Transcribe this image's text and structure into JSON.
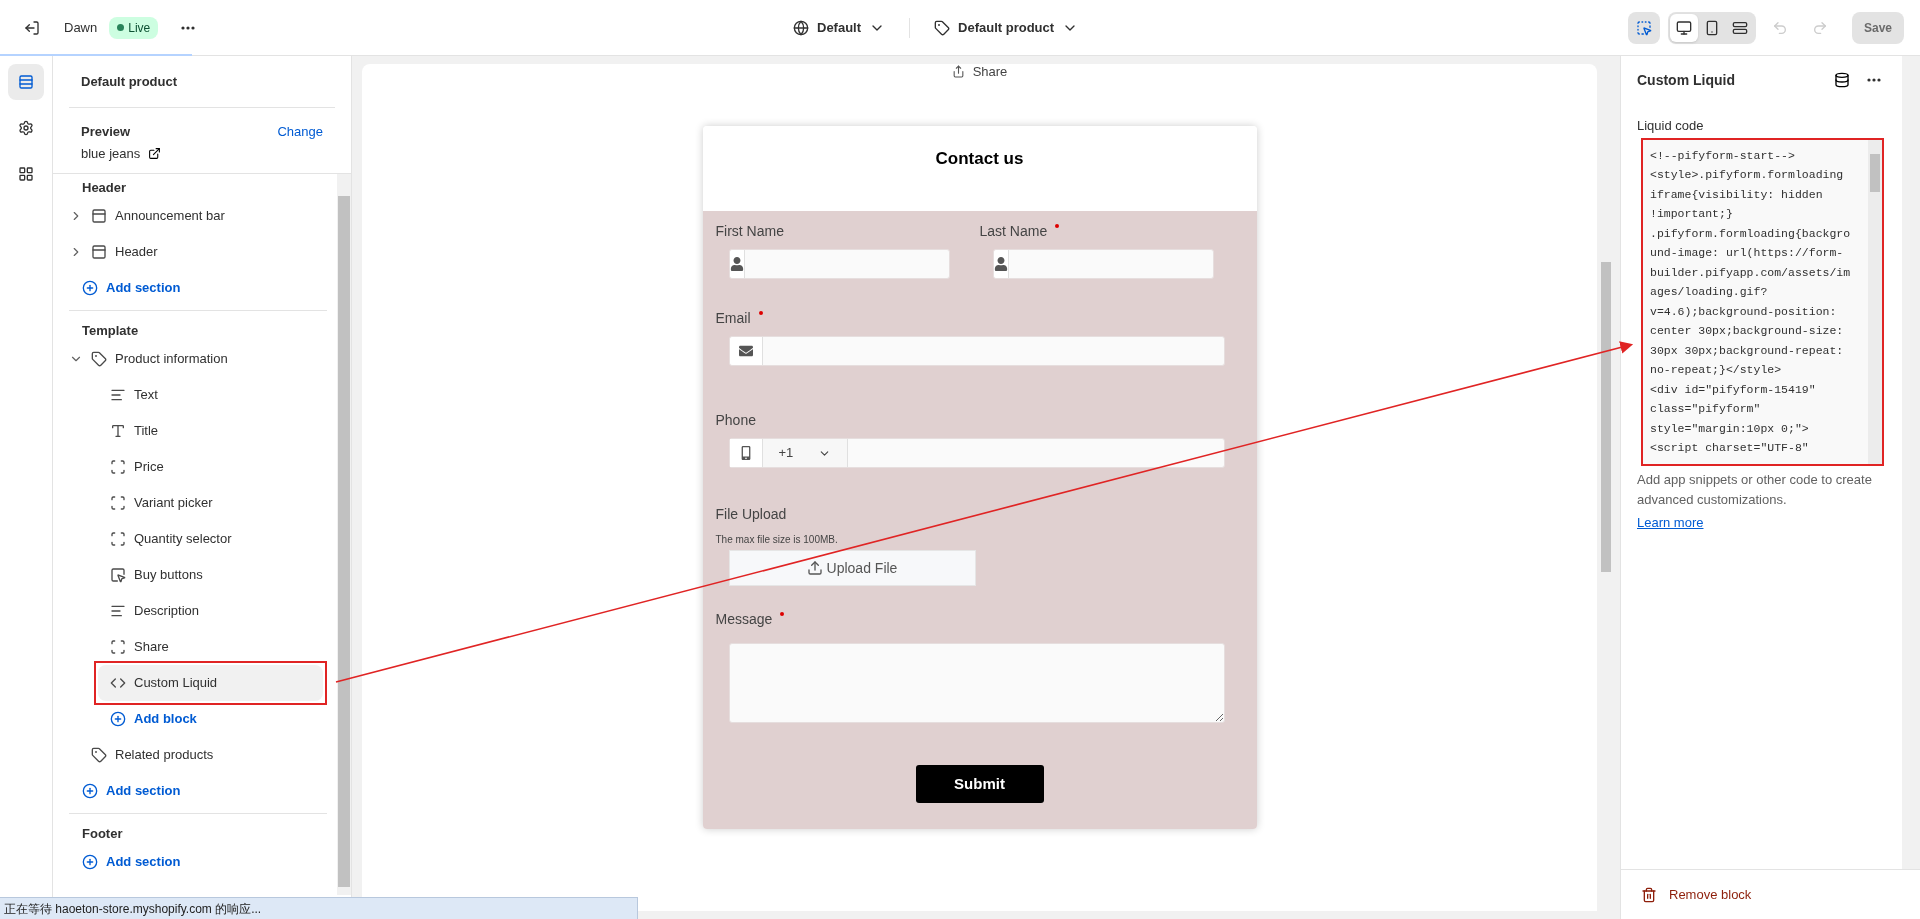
{
  "topbar": {
    "theme": "Dawn",
    "status": "Live",
    "locale": "Default",
    "template": "Default product",
    "tools": [
      {
        "kind": "inspector",
        "selected": true
      }
    ],
    "viewports": [
      {
        "kind": "desktop",
        "selected": true
      },
      {
        "kind": "mobile",
        "selected": false
      },
      {
        "kind": "fullwidth",
        "selected": false
      }
    ],
    "history": [
      {
        "kind": "undo",
        "disabled": true
      },
      {
        "kind": "redo",
        "disabled": true
      }
    ],
    "save": {
      "label": "Save",
      "disabled": true
    }
  },
  "rail": [
    {
      "kind": "sections",
      "selected": true
    },
    {
      "kind": "settings",
      "selected": false
    },
    {
      "kind": "apps",
      "selected": false
    }
  ],
  "sidebar": {
    "title": "Default product",
    "preview": {
      "label": "Preview",
      "action": "Change",
      "value": "blue jeans"
    },
    "groups": [
      {
        "title": "Header",
        "items": [
          {
            "label": "Announcement bar",
            "kind": "section",
            "expanded": false
          },
          {
            "label": "Header",
            "kind": "section",
            "expanded": false
          }
        ],
        "add": "Add section"
      },
      {
        "title": "Template",
        "items": [
          {
            "label": "Product information",
            "kind": "tag",
            "expanded": true,
            "add_block": "Add block",
            "children": [
              {
                "label": "Text",
                "kind": "text",
                "selected": false,
                "annotated": false
              },
              {
                "label": "Title",
                "kind": "title",
                "selected": false,
                "annotated": false
              },
              {
                "label": "Price",
                "kind": "frame",
                "selected": false,
                "annotated": false
              },
              {
                "label": "Variant picker",
                "kind": "frame",
                "selected": false,
                "annotated": false
              },
              {
                "label": "Quantity selector",
                "kind": "frame",
                "selected": false,
                "annotated": false
              },
              {
                "label": "Buy buttons",
                "kind": "buy",
                "selected": false,
                "annotated": false
              },
              {
                "label": "Description",
                "kind": "text",
                "selected": false,
                "annotated": false
              },
              {
                "label": "Share",
                "kind": "frame",
                "selected": false,
                "annotated": false
              },
              {
                "label": "Custom Liquid",
                "kind": "code",
                "selected": true,
                "annotated": true
              }
            ]
          },
          {
            "label": "Related products",
            "kind": "tag"
          }
        ],
        "add": "Add section"
      },
      {
        "title": "Footer",
        "add": "Add section"
      }
    ]
  },
  "preview": {
    "share": "Share",
    "form": {
      "title": "Contact us",
      "fields": [
        {
          "kind": "name",
          "label": "First Name",
          "required": false
        },
        {
          "kind": "name",
          "label": "Last Name",
          "required": true
        },
        {
          "kind": "email",
          "label": "Email",
          "required": true
        },
        {
          "kind": "phone",
          "label": "Phone",
          "required": false,
          "country": "+1"
        },
        {
          "kind": "file",
          "label": "File Upload",
          "required": false,
          "hint": "The max file size is 100MB.",
          "button": "Upload File"
        },
        {
          "kind": "textarea",
          "label": "Message",
          "required": true
        }
      ],
      "submit": "Submit"
    }
  },
  "inspector": {
    "title": "Custom Liquid",
    "field_label": "Liquid code",
    "annotated": true,
    "code": [
      "<!--pifyform-start-->",
      "<style>.pifyform.formloading",
      "iframe{visibility: hidden",
      "!important;}",
      ".pifyform.formloading{backgro",
      "und-image: url(https://form-",
      "builder.pifyapp.com/assets/im",
      "ages/loading.gif?",
      "v=4.6);background-position:",
      "center 30px;background-size:",
      "30px 30px;background-repeat:",
      "no-repeat;}</style>",
      "<div id=\"pifyform-15419\"",
      "class=\"pifyform\"",
      "style=\"margin:10px 0;\">",
      "<script charset=\"UTF-8\""
    ],
    "help": "Add app snippets or other code to create advanced customizations.",
    "link": "Learn more",
    "remove": "Remove block"
  },
  "status_bar": "正在等待 haoeton-store.myshopify.com 的响应..."
}
